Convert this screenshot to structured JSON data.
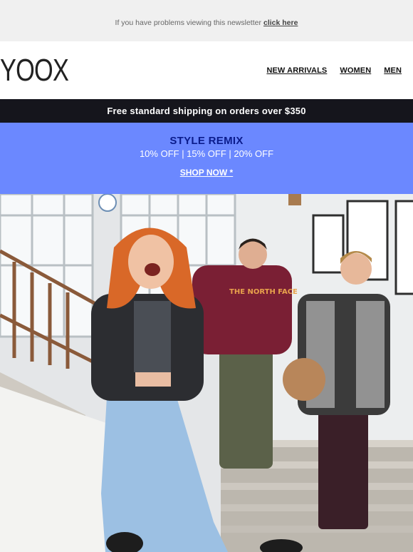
{
  "preheader": {
    "text": "If you have problems viewing this newsletter",
    "link_label": "click here"
  },
  "header": {
    "logo": "YOOX",
    "nav": [
      {
        "label": "NEW ARRIVALS"
      },
      {
        "label": "WOMEN"
      },
      {
        "label": "MEN"
      }
    ]
  },
  "shipping_bar": {
    "text": "Free standard shipping on orders over $350"
  },
  "promo": {
    "title": "STYLE REMIX",
    "discounts": "10% OFF | 15% OFF | 20% OFF",
    "cta_label": "SHOP NOW *",
    "background": "#6b88ff",
    "title_color": "#0b1c8c"
  },
  "hero": {
    "hoodie_text": "THE NORTH FACE"
  }
}
